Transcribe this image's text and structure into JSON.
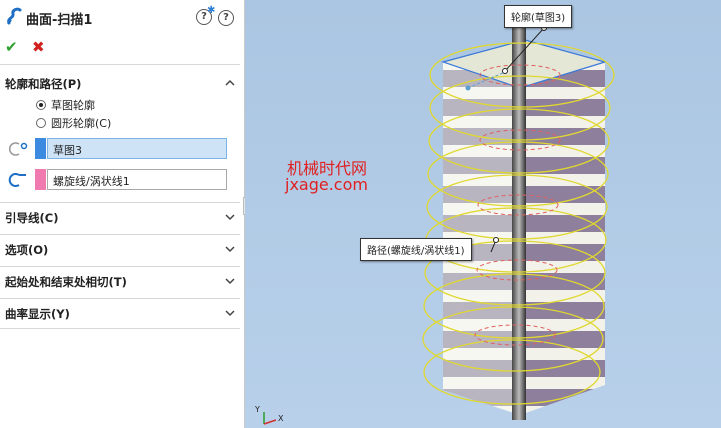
{
  "header": {
    "title": "曲面-扫描1"
  },
  "actions": {
    "ok": "✔",
    "cancel": "✖"
  },
  "profile_path": {
    "heading": "轮廓和路径(P)",
    "options": [
      {
        "label": "草图轮廓",
        "selected": true
      },
      {
        "label": "圆形轮廓(C)",
        "selected": false
      }
    ],
    "profile_value": "草图3",
    "profile_color": "#3d8be0",
    "path_value": "螺旋线/涡状线1",
    "path_color": "#f07ab0"
  },
  "sections": [
    {
      "label": "引导线(C)"
    },
    {
      "label": "选项(O)"
    },
    {
      "label": "起始处和结束处相切(T)"
    },
    {
      "label": "曲率显示(Y)"
    }
  ],
  "viewport": {
    "watermark_line1": "机械时代网",
    "watermark_line2": "jxage.com",
    "callout_profile": "轮廓(草图3)",
    "callout_path": "路径(螺旋线/涡状线1)",
    "axis_y": "Y",
    "axis_x": "X"
  }
}
